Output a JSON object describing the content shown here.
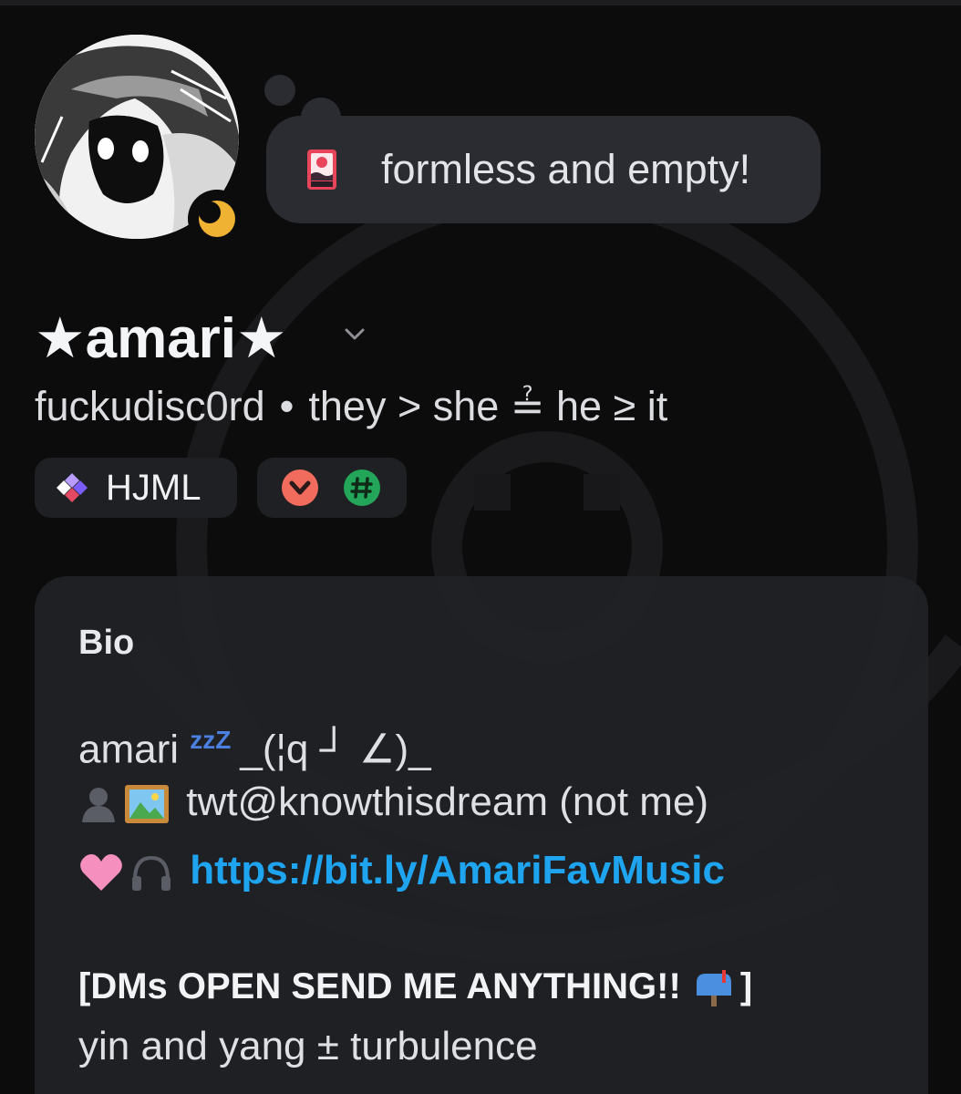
{
  "profile": {
    "custom_status": "formless and empty!",
    "display_name": "★amari★",
    "username": "fuckudisc0rd",
    "separator": "•",
    "pronouns": "they > she ≟ he ≥ it",
    "clan_tag": "HJML",
    "status": "idle",
    "status_color": "#f0b232",
    "badges": [
      "chevron-badge-icon",
      "hashtag-badge-icon"
    ],
    "badge_colors": [
      "#f26c5e",
      "#23a55a"
    ]
  },
  "bio": {
    "heading": "Bio",
    "line1_text": "amari",
    "line1_zzz": "zzZ",
    "line1_kaomoji": "_(¦q ┘ ∠)_",
    "line2_text": "twt@knowthisdream (not me)",
    "line3_link": "https://bit.ly/AmariFavMusic",
    "line4_text": "[DMs OPEN SEND ME ANYTHING!!",
    "line4_end": "]",
    "line5_text": "yin and yang ± turbulence",
    "link_color": "#1fa5f0"
  },
  "icons": {
    "status_emoji": "hanafuda-card-icon",
    "line2_icons": [
      "bust-silhouette-icon",
      "framed-picture-icon"
    ],
    "line3_icons": [
      "pink-heart-icon",
      "headphone-icon"
    ],
    "line4_icon": "mailbox-icon"
  }
}
